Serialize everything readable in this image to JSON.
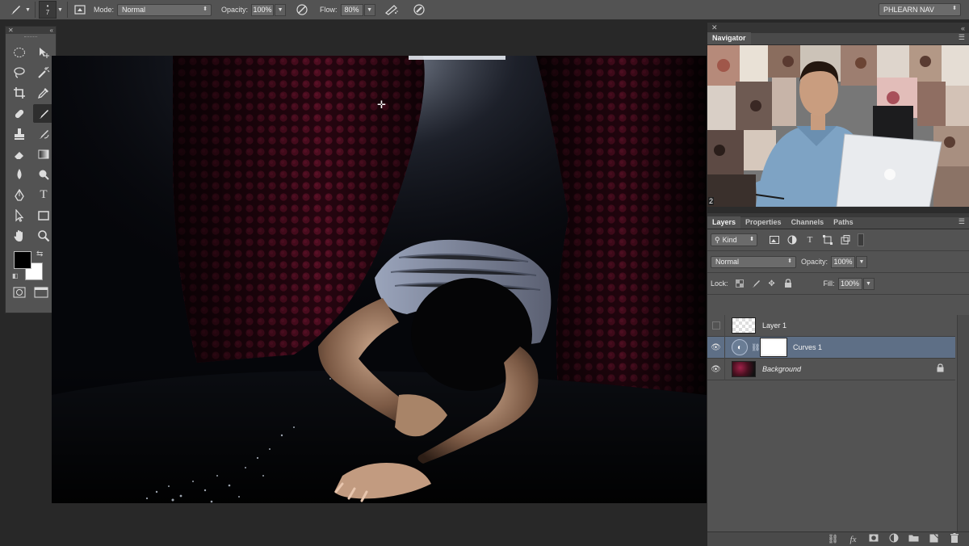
{
  "options_bar": {
    "brush_size": "7",
    "mode_label": "Mode:",
    "mode_value": "Normal",
    "opacity_label": "Opacity:",
    "opacity_value": "100%",
    "flow_label": "Flow:",
    "flow_value": "80%",
    "workspace_value": "PHLEARN NAV",
    "icons": [
      "brush-tool-icon",
      "brush-preset-icon",
      "brush-panel-icon",
      "pressure-opacity-icon",
      "airbrush-icon",
      "pressure-size-icon"
    ]
  },
  "toolbox": {
    "tools": [
      "elliptical-marquee-icon",
      "move-tool-icon",
      "lasso-tool-icon",
      "magic-wand-icon",
      "crop-tool-icon",
      "eyedropper-icon",
      "healing-brush-icon",
      "brush-tool-icon",
      "clone-stamp-icon",
      "history-brush-icon",
      "eraser-icon",
      "gradient-tool-icon",
      "blur-tool-icon",
      "dodge-tool-icon",
      "pen-tool-icon",
      "type-tool-icon",
      "path-selection-icon",
      "rectangle-tool-icon",
      "hand-tool-icon",
      "zoom-tool-icon"
    ],
    "foreground_color": "#000000",
    "background_color": "#ffffff"
  },
  "navigator": {
    "tab": "Navigator",
    "zoom_number": "2"
  },
  "layers": {
    "tabs": [
      "Layers",
      "Properties",
      "Channels",
      "Paths"
    ],
    "kind_label": "Kind",
    "blend_mode": "Normal",
    "opacity_label": "Opacity:",
    "opacity_value": "100%",
    "lock_label": "Lock:",
    "fill_label": "Fill:",
    "fill_value": "100%",
    "items": [
      {
        "name": "Layer 1",
        "visible": false,
        "selected": false
      },
      {
        "name": "Curves 1",
        "visible": true,
        "selected": true
      },
      {
        "name": "Background",
        "visible": true,
        "selected": false,
        "locked": true
      }
    ],
    "bottom_icons": [
      "link-layers-icon",
      "fx-icon",
      "add-mask-icon",
      "adjustment-layer-icon",
      "new-group-icon",
      "new-layer-icon",
      "trash-icon"
    ]
  },
  "colors": {
    "panel_bg": "#535353",
    "selected_layer": "#5e6f86",
    "curtain_red": "#8a1838"
  }
}
